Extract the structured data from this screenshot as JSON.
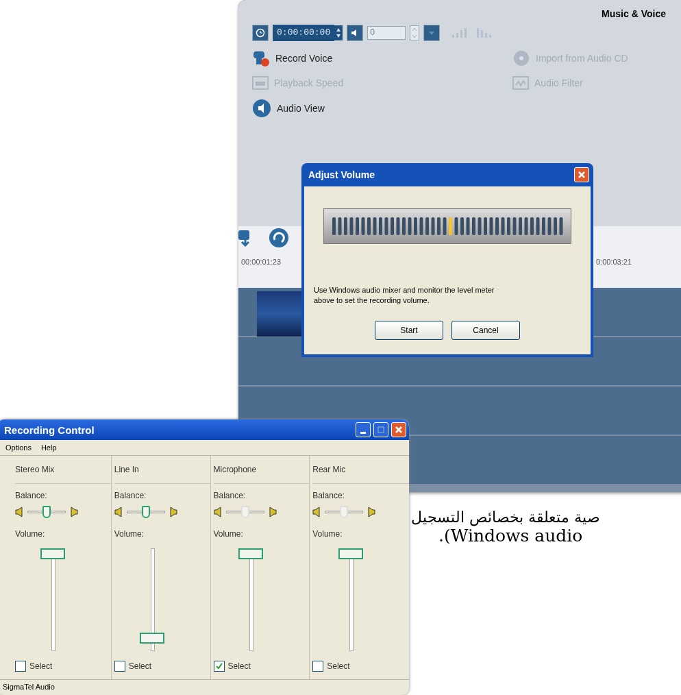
{
  "music_panel": {
    "title": "Music & Voice",
    "time_field": {
      "value": "0:00:00:00"
    },
    "volume_field": {
      "value": "0",
      "disabled": true
    },
    "actions": [
      {
        "label": "Record Voice",
        "disabled": false,
        "kind": "record"
      },
      {
        "label": "Import from Audio CD",
        "disabled": true,
        "kind": "cd"
      },
      {
        "label": "Playback Speed",
        "disabled": true,
        "kind": "speed"
      },
      {
        "label": "Audio Filter",
        "disabled": true,
        "kind": "filter"
      },
      {
        "label": "Audio View",
        "disabled": false,
        "kind": "view"
      }
    ],
    "timeline": {
      "timecodes": [
        "00:00:01:23",
        "0:00:03:21"
      ]
    }
  },
  "adjust_volume": {
    "title": "Adjust Volume",
    "meter": {
      "level": 0.5
    },
    "message": "Use Windows audio mixer and monitor the level meter above to set the recording volume.",
    "buttons": [
      "Start",
      "Cancel"
    ]
  },
  "recording_control": {
    "title": "Recording Control",
    "menu": [
      "Options",
      "Help"
    ],
    "channels": [
      {
        "name": "Stereo Mix",
        "balance_label": "Balance:",
        "balance": {
          "level": 0.5,
          "disabled": false
        },
        "volume_label": "Volume:",
        "volume": {
          "level": 1.0
        },
        "select": {
          "label": "Select",
          "checked": false
        }
      },
      {
        "name": "Line In",
        "balance_label": "Balance:",
        "balance": {
          "level": 0.5,
          "disabled": false
        },
        "volume_label": "Volume:",
        "volume": {
          "level": 0.08
        },
        "select": {
          "label": "Select",
          "checked": false
        }
      },
      {
        "name": "Microphone",
        "balance_label": "Balance:",
        "balance": {
          "level": 0.5,
          "disabled": true
        },
        "volume_label": "Volume:",
        "volume": {
          "level": 1.0
        },
        "select": {
          "label": "Select",
          "checked": true
        }
      },
      {
        "name": "Rear Mic",
        "balance_label": "Balance:",
        "balance": {
          "level": 0.5,
          "disabled": true
        },
        "volume_label": "Volume:",
        "volume": {
          "level": 1.0
        },
        "select": {
          "label": "Select",
          "checked": false
        }
      }
    ],
    "status_bar": "SigmaTel Audio"
  },
  "page_text": [
    "صية متعلقة بخصائص التسجيل",
    ".(Windows audio"
  ]
}
